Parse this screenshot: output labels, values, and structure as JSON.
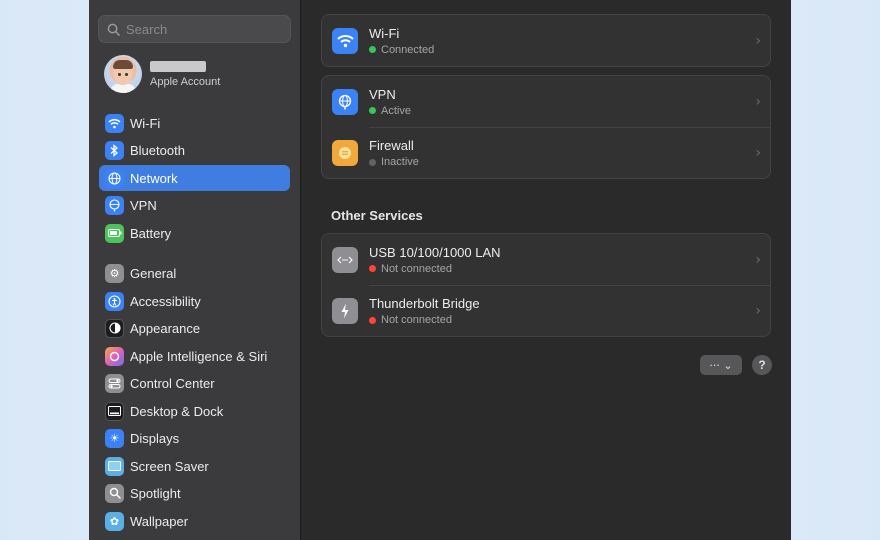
{
  "search": {
    "placeholder": "Search"
  },
  "account": {
    "label": "Apple Account"
  },
  "sidebar": {
    "items": [
      {
        "label": "Wi-Fi",
        "icon": "wifi-icon",
        "color": "#3b82f6"
      },
      {
        "label": "Bluetooth",
        "icon": "bluetooth-icon",
        "color": "#3b82f6"
      },
      {
        "label": "Network",
        "icon": "globe-icon",
        "color": "#3b82f6",
        "selected": true
      },
      {
        "label": "VPN",
        "icon": "vpn-icon",
        "color": "#3b82f6"
      },
      {
        "label": "Battery",
        "icon": "battery-icon",
        "color": "#4cc45e"
      },
      {
        "label": "General",
        "icon": "gear-icon",
        "color": "#8e8e93"
      },
      {
        "label": "Accessibility",
        "icon": "accessibility-icon",
        "color": "#3b82f6"
      },
      {
        "label": "Appearance",
        "icon": "appearance-icon",
        "color": "#1c1c1e"
      },
      {
        "label": "Apple Intelligence & Siri",
        "icon": "siri-icon",
        "color": "#e062b5"
      },
      {
        "label": "Control Center",
        "icon": "control-center-icon",
        "color": "#8e8e93"
      },
      {
        "label": "Desktop & Dock",
        "icon": "dock-icon",
        "color": "#1c1c1e"
      },
      {
        "label": "Displays",
        "icon": "displays-icon",
        "color": "#3b82f6"
      },
      {
        "label": "Screen Saver",
        "icon": "screen-saver-icon",
        "color": "#5ab0e6"
      },
      {
        "label": "Spotlight",
        "icon": "spotlight-icon",
        "color": "#8e8e93"
      },
      {
        "label": "Wallpaper",
        "icon": "wallpaper-icon",
        "color": "#5ab0e6"
      }
    ]
  },
  "main": {
    "wifi": {
      "title": "Wi-Fi",
      "status": "Connected",
      "status_color": "#34c759"
    },
    "vpn": {
      "title": "VPN",
      "status": "Active",
      "status_color": "#34c759"
    },
    "firewall": {
      "title": "Firewall",
      "status": "Inactive",
      "status_color": "#8e8e93"
    },
    "other_services_heading": "Other Services",
    "usb": {
      "title": "USB 10/100/1000 LAN",
      "status": "Not connected",
      "status_color": "#ff453a"
    },
    "thunderbolt": {
      "title": "Thunderbolt Bridge",
      "status": "Not connected",
      "status_color": "#ff453a"
    },
    "more_label": "··· ⌄",
    "help_label": "?"
  }
}
